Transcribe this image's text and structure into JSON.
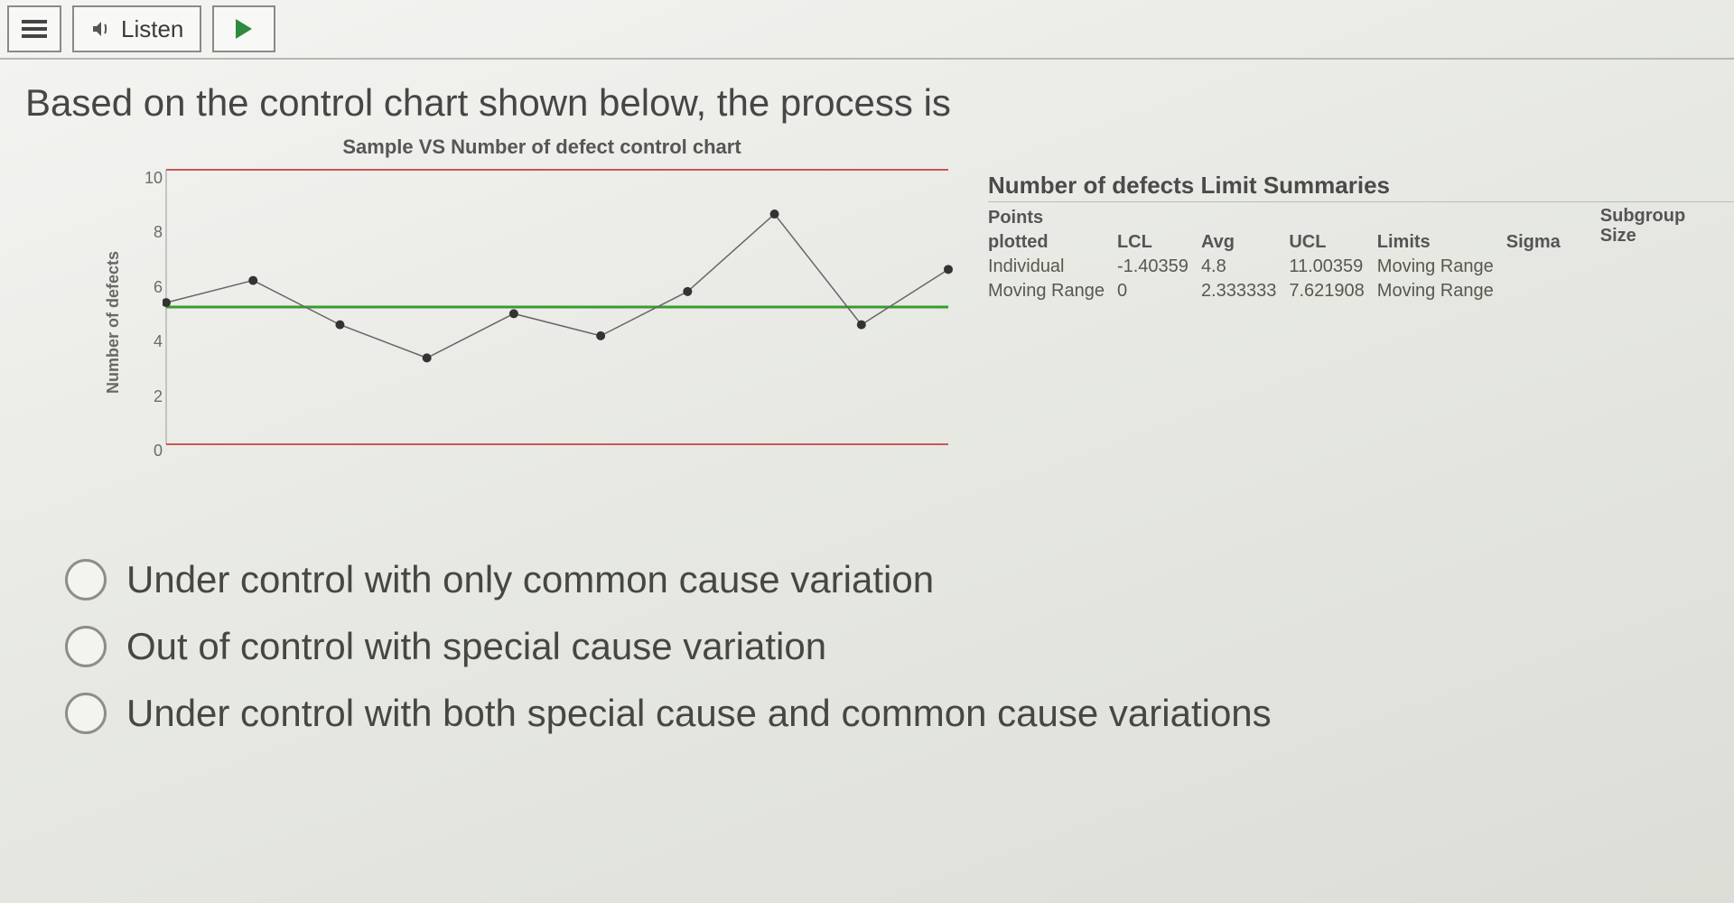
{
  "toolbar": {
    "listen_label": "Listen"
  },
  "question": "Based on the control chart shown below, the process is",
  "chart_data": {
    "type": "line",
    "title": "Sample VS Number of defect control chart",
    "ylabel": "Number of defects",
    "ylim": [
      -1.4,
      11
    ],
    "yticks": [
      10,
      8,
      6,
      4,
      2,
      0
    ],
    "x": [
      1,
      2,
      3,
      4,
      5,
      6,
      7,
      8,
      9,
      10
    ],
    "values": [
      5,
      6,
      4,
      2.5,
      4.5,
      3.5,
      5.5,
      9,
      4,
      6.5
    ],
    "centerline": 4.8,
    "ucl": 11.0,
    "lcl": -1.4
  },
  "summary": {
    "heading": "Number of defects Limit Summaries",
    "head_points": "Points",
    "head_plotted": "plotted",
    "head_lcl": "LCL",
    "head_avg": "Avg",
    "head_ucl": "UCL",
    "head_limits": "Limits",
    "head_sigma": "Sigma",
    "head_subgroup": "Subgroup",
    "head_size": "Size",
    "rows": [
      {
        "name": "Individual",
        "lcl": "-1.40359",
        "avg": "4.8",
        "ucl": "11.00359",
        "sigma": "Moving Range"
      },
      {
        "name": "Moving Range",
        "lcl": "0",
        "avg": "2.333333",
        "ucl": "7.621908",
        "sigma": "Moving Range"
      }
    ]
  },
  "options": {
    "a": "Under control with only common cause variation",
    "b": "Out of control with special cause variation",
    "c": "Under control with both special cause and common cause variations"
  }
}
